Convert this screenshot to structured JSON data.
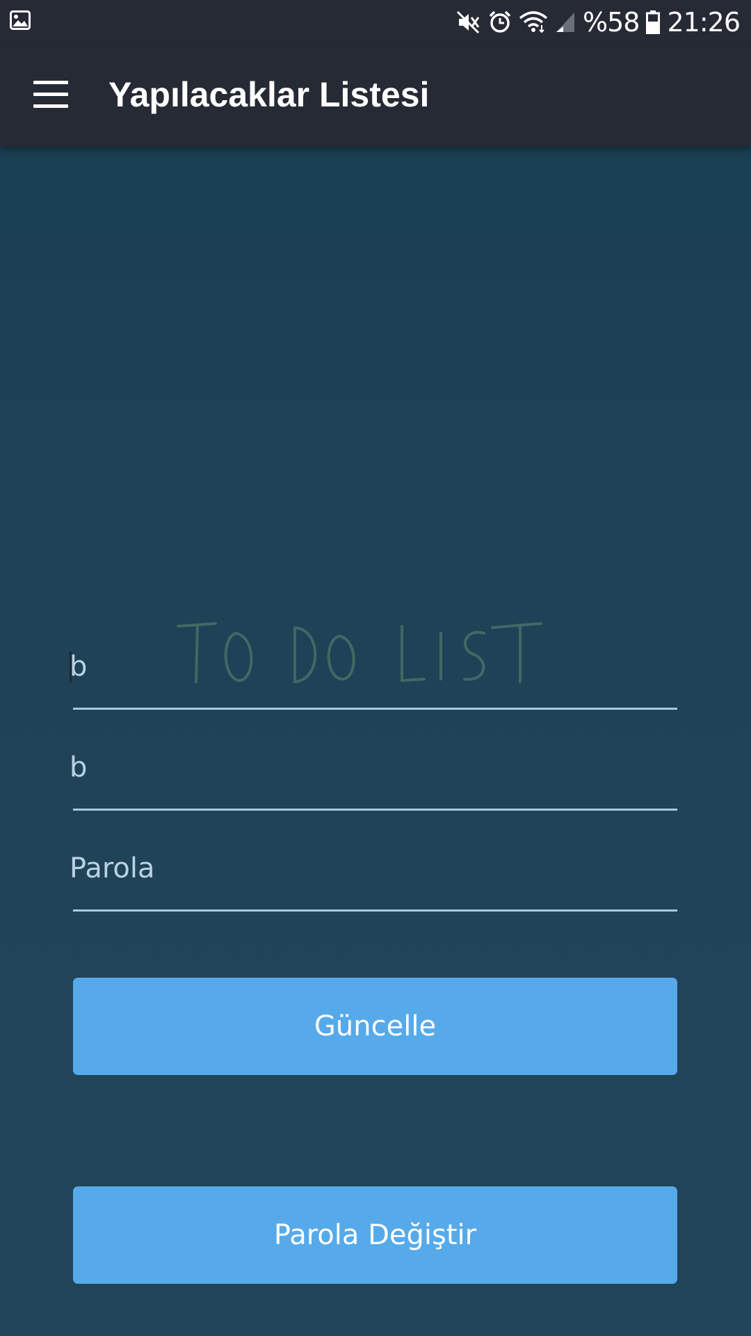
{
  "status_bar": {
    "battery_percent": "%58",
    "time": "21:26",
    "icons": [
      "gallery-icon",
      "mute-icon",
      "alarm-icon",
      "wifi-icon",
      "signal-icon",
      "battery-icon"
    ]
  },
  "app_bar": {
    "title": "Yapılacaklar Listesi",
    "menu_icon": "hamburger-menu-icon"
  },
  "background": {
    "logo_text": "TO DO LIST"
  },
  "form": {
    "field1": {
      "value": "b"
    },
    "field2": {
      "value": "b"
    },
    "password": {
      "placeholder": "Parola",
      "value": ""
    }
  },
  "buttons": {
    "update_label": "Güncelle",
    "change_password_label": "Parola Değiştir"
  },
  "colors": {
    "toolbar": "#262a35",
    "background": "#1f4257",
    "button": "#56aaea",
    "underline": "#a9cbe0"
  }
}
